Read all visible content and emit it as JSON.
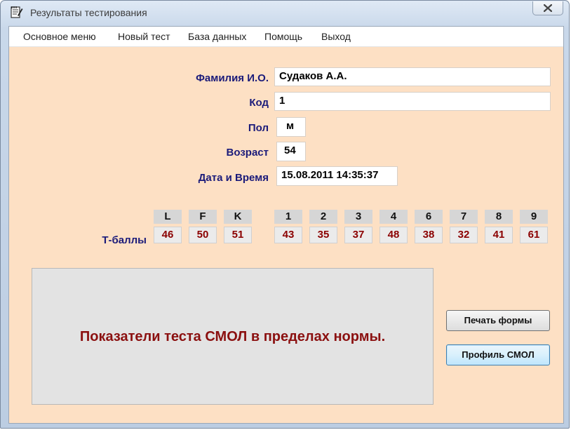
{
  "window": {
    "title": "Результаты тестирования"
  },
  "menu": {
    "items": [
      "Основное меню",
      "Новый тест",
      "База данных",
      "Помощь",
      "Выход"
    ]
  },
  "form": {
    "name_label": "Фамилия И.О.",
    "name_value": "Судаков А.А.",
    "code_label": "Код",
    "code_value": "1",
    "sex_label": "Пол",
    "sex_value": "м",
    "age_label": "Возраст",
    "age_value": "54",
    "datetime_label": "Дата и Время",
    "datetime_value": "15.08.2011 14:35:37"
  },
  "scores": {
    "row_label": "Т-баллы",
    "validity": [
      {
        "scale": "L",
        "value": "46"
      },
      {
        "scale": "F",
        "value": "50"
      },
      {
        "scale": "K",
        "value": "51"
      }
    ],
    "clinical": [
      {
        "scale": "1",
        "value": "43"
      },
      {
        "scale": "2",
        "value": "35"
      },
      {
        "scale": "3",
        "value": "37"
      },
      {
        "scale": "4",
        "value": "48"
      },
      {
        "scale": "6",
        "value": "38"
      },
      {
        "scale": "7",
        "value": "32"
      },
      {
        "scale": "8",
        "value": "41"
      },
      {
        "scale": "9",
        "value": "61"
      }
    ]
  },
  "result": {
    "message": "Показатели теста СМОЛ в пределах нормы."
  },
  "buttons": {
    "print_label": "Печать формы",
    "profile_label": "Профиль СМОЛ"
  },
  "colors": {
    "background": "#fde0c4",
    "label_text": "#1b1b7a",
    "score_text": "#8b0000",
    "result_text": "#8b1010"
  }
}
